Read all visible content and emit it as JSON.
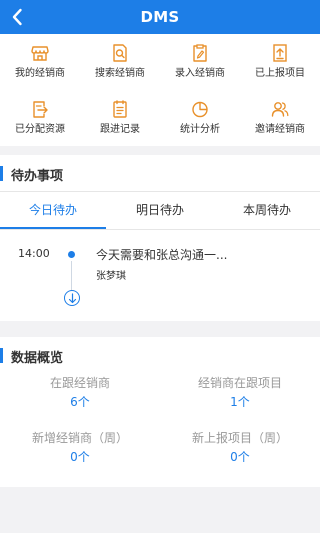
{
  "header": {
    "title": "DMS",
    "back_icon": "chevron-left-icon"
  },
  "colors": {
    "accent": "#1d7ee7",
    "orange": "#e8902a"
  },
  "menu": [
    {
      "label": "我的经销商",
      "icon": "store-icon"
    },
    {
      "label": "搜索经销商",
      "icon": "search-document-icon"
    },
    {
      "label": "录入经销商",
      "icon": "clipboard-edit-icon"
    },
    {
      "label": "已上报项目",
      "icon": "upload-document-icon"
    },
    {
      "label": "已分配资源",
      "icon": "document-export-icon"
    },
    {
      "label": "跟进记录",
      "icon": "notes-list-icon"
    },
    {
      "label": "统计分析",
      "icon": "pie-chart-icon"
    },
    {
      "label": "邀请经销商",
      "icon": "users-icon"
    }
  ],
  "todo": {
    "title": "待办事项",
    "tabs": [
      "今日待办",
      "明日待办",
      "本周待办"
    ],
    "active_tab": "今日待办",
    "items": [
      {
        "time": "14:00",
        "title": "今天需要和张总沟通一...",
        "person": "张梦琪"
      }
    ],
    "more_icon": "arrow-down-circle-icon"
  },
  "overview": {
    "title": "数据概览",
    "stats": [
      {
        "label": "在跟经销商",
        "value": "6个"
      },
      {
        "label": "经销商在跟项目",
        "value": "1个"
      },
      {
        "label": "新增经销商（周）",
        "value": "0个"
      },
      {
        "label": "新上报项目（周）",
        "value": "0个"
      }
    ]
  }
}
